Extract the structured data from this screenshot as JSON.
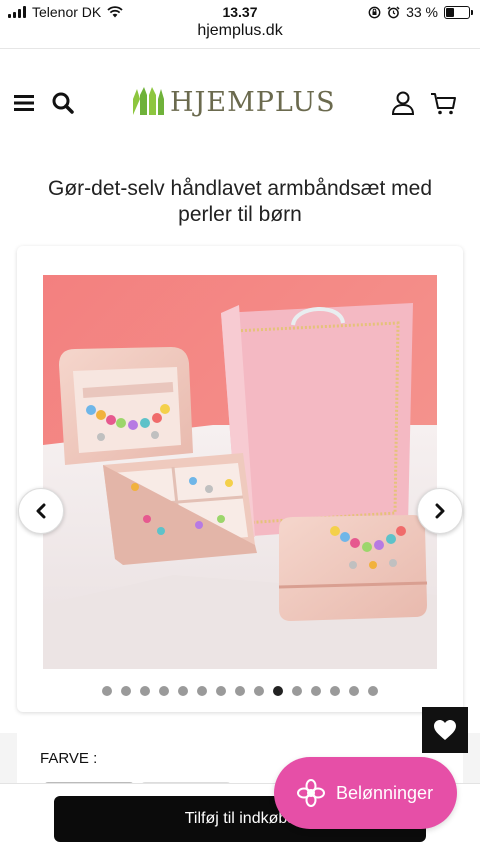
{
  "status_bar": {
    "carrier": "Telenor DK",
    "time": "13.37",
    "battery": "33 %"
  },
  "browser": {
    "url": "hjemplus.dk"
  },
  "header": {
    "logo_text": "HJEMPLUS",
    "icons": [
      "menu-icon",
      "search-icon",
      "account-icon",
      "cart-icon"
    ]
  },
  "product": {
    "title": "Gør-det-selv håndlavet armbåndsæt med perler til børn"
  },
  "gallery": {
    "image_count": 15,
    "active_index": 9
  },
  "options": {
    "color_label": "FARVE :"
  },
  "cart": {
    "add_label": "Tilføj til indkøbs"
  },
  "rewards": {
    "label": "Belønninger",
    "color": "#e64fa7"
  }
}
